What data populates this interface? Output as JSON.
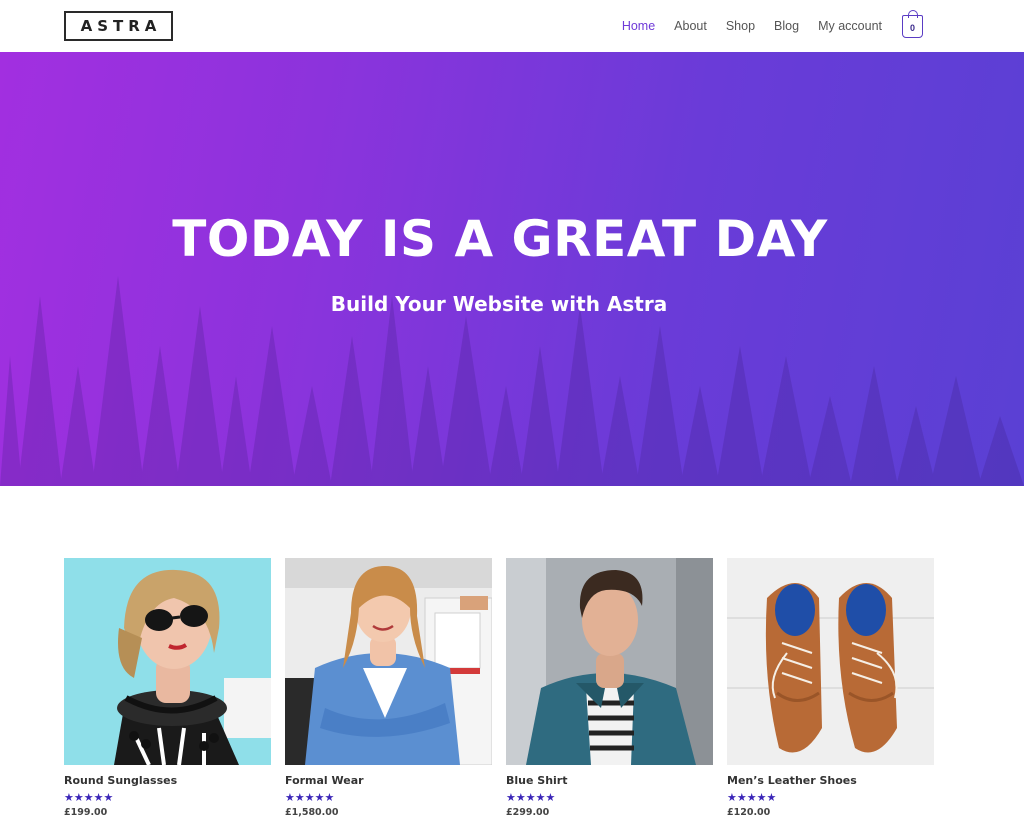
{
  "header": {
    "logo": "ASTRA",
    "nav": [
      {
        "label": "Home",
        "active": true
      },
      {
        "label": "About",
        "active": false
      },
      {
        "label": "Shop",
        "active": false
      },
      {
        "label": "Blog",
        "active": false
      },
      {
        "label": "My account",
        "active": false
      }
    ],
    "cart_count": "0"
  },
  "hero": {
    "title": "TODAY IS A GREAT DAY",
    "subtitle": "Build Your Website with Astra"
  },
  "products": [
    {
      "title": "Round Sunglasses",
      "stars": "★★★★★",
      "price": "£199.00"
    },
    {
      "title": "Formal Wear",
      "stars": "★★★★★",
      "price": "£1,580.00"
    },
    {
      "title": "Blue Shirt",
      "stars": "★★★★★",
      "price": "£299.00"
    },
    {
      "title": "Men’s Leather Shoes",
      "stars": "★★★★★",
      "price": "£120.00"
    }
  ],
  "colors": {
    "accent": "#6f3ad8",
    "hero_gradient_start": "#a22fe0",
    "hero_gradient_end": "#5a40d4",
    "stars": "#3b26b8"
  }
}
